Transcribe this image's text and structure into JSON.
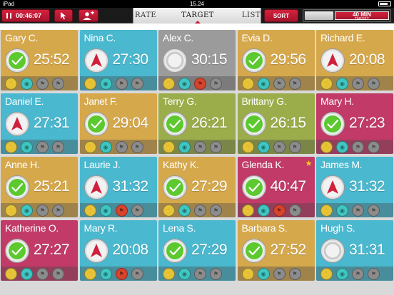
{
  "status_bar": {
    "carrier": "iPad",
    "clock": "15.24"
  },
  "toolbar": {
    "timer": "00:46:07",
    "cursor_icon": "cursor-icon",
    "add_user_icon": "add-user-icon",
    "tabs": [
      "RATE",
      "TARGET",
      "LIST"
    ],
    "selected_tab": "TARGET",
    "sort_label": "SORT",
    "session_timer": {
      "label": "40 MIN",
      "sublabel": "TARGET",
      "progress": 0.65
    }
  },
  "colors": {
    "gold": "#d6a84c",
    "teal": "#4ab8cf",
    "grey": "#9b9b9b",
    "olive": "#9aad4a",
    "magenta": "#c23a68",
    "accent": "#c51c37"
  },
  "students": [
    {
      "name": "Gary C.",
      "time": "25:52",
      "color": "gold",
      "status": "check",
      "badges": [
        "yellow",
        "teal",
        "grey",
        "grey"
      ]
    },
    {
      "name": "Nina C.",
      "time": "27:30",
      "color": "teal",
      "status": "arrow",
      "badges": [
        "yellow",
        "teal",
        "grey",
        "grey"
      ]
    },
    {
      "name": "Alex C.",
      "time": "30:15",
      "color": "grey",
      "status": "pending",
      "badges": [
        "yellow",
        "teal",
        "red",
        "grey"
      ]
    },
    {
      "name": "Evia D.",
      "time": "29:56",
      "color": "gold",
      "status": "check",
      "badges": [
        "yellow",
        "teal",
        "grey",
        "grey"
      ]
    },
    {
      "name": "Richard E.",
      "time": "20:08",
      "color": "gold",
      "status": "arrow",
      "badges": [
        "yellow",
        "teal",
        "grey",
        "grey"
      ]
    },
    {
      "name": "Daniel E.",
      "time": "27:31",
      "color": "teal",
      "status": "arrow",
      "badges": [
        "yellow",
        "teal",
        "grey",
        "grey"
      ]
    },
    {
      "name": "Janet F.",
      "time": "29:04",
      "color": "gold",
      "status": "check",
      "badges": [
        "yellow",
        "teal",
        "grey",
        "grey"
      ]
    },
    {
      "name": "Terry G.",
      "time": "26:21",
      "color": "olive",
      "status": "check",
      "badges": [
        "yellow",
        "teal",
        "grey",
        "grey"
      ]
    },
    {
      "name": "Brittany G.",
      "time": "26:15",
      "color": "olive",
      "status": "check",
      "badges": [
        "yellow",
        "teal",
        "grey",
        "grey"
      ]
    },
    {
      "name": "Mary H.",
      "time": "27:23",
      "color": "magenta",
      "status": "check",
      "badges": [
        "yellow",
        "teal",
        "grey",
        "grey"
      ]
    },
    {
      "name": "Anne H.",
      "time": "25:21",
      "color": "gold",
      "status": "check",
      "badges": [
        "yellow",
        "teal",
        "grey",
        "grey"
      ]
    },
    {
      "name": "Laurie J.",
      "time": "31:32",
      "color": "teal",
      "status": "arrow",
      "badges": [
        "yellow",
        "teal",
        "red",
        "grey"
      ]
    },
    {
      "name": "Kathy K.",
      "time": "27:29",
      "color": "gold",
      "status": "check",
      "badges": [
        "yellow",
        "teal",
        "grey",
        "grey"
      ]
    },
    {
      "name": "Glenda K.",
      "time": "40:47",
      "color": "magenta",
      "status": "check",
      "star": true,
      "badges": [
        "yellow",
        "teal",
        "red",
        "grey"
      ]
    },
    {
      "name": "James M.",
      "time": "31:32",
      "color": "teal",
      "status": "arrow",
      "badges": [
        "yellow",
        "teal",
        "grey",
        "grey"
      ]
    },
    {
      "name": "Katherine O.",
      "time": "27:27",
      "color": "magenta",
      "status": "check",
      "badges": [
        "yellow",
        "teal",
        "grey",
        "grey"
      ]
    },
    {
      "name": "Mary R.",
      "time": "20:08",
      "color": "teal",
      "status": "arrow",
      "badges": [
        "yellow",
        "teal",
        "red",
        "grey"
      ]
    },
    {
      "name": "Lena S.",
      "time": "27:29",
      "color": "teal",
      "status": "check",
      "badges": [
        "yellow",
        "teal",
        "grey",
        "grey"
      ]
    },
    {
      "name": "Barbara S.",
      "time": "27:52",
      "color": "gold",
      "status": "check",
      "badges": [
        "yellow",
        "teal",
        "grey",
        "grey"
      ]
    },
    {
      "name": "Hugh S.",
      "time": "31:31",
      "color": "teal",
      "status": "pending",
      "badges": [
        "yellow",
        "teal",
        "grey",
        "grey"
      ]
    }
  ]
}
